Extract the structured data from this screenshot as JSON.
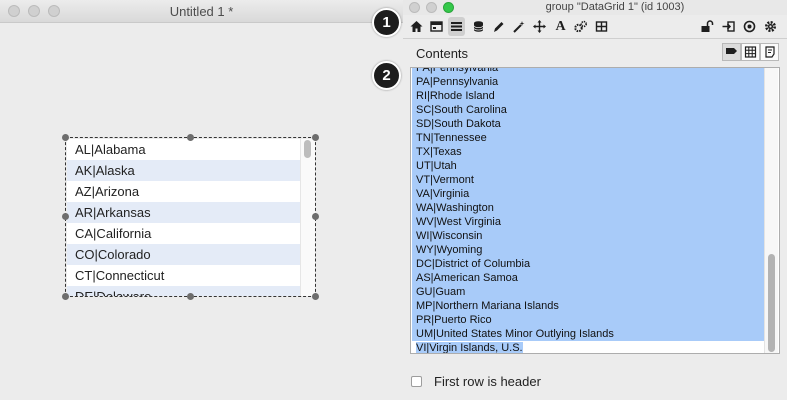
{
  "left_window": {
    "title": "Untitled 1 *",
    "grid_rows": [
      "AL|Alabama",
      "AK|Alaska",
      "AZ|Arizona",
      "AR|Arkansas",
      "CA|California",
      "CO|Colorado",
      "CT|Connecticut",
      "DE|Delaware"
    ]
  },
  "inspector": {
    "title": "group \"DataGrid 1\" (id 1003)",
    "toolbar_icons": [
      "home-icon",
      "card-icon",
      "list-icon",
      "database-icon",
      "pencil-icon",
      "magic-wand-icon",
      "move-icon",
      "text-icon",
      "gears-icon",
      "grid-icon"
    ],
    "toolbar_right_icons": [
      "lock-icon",
      "enter-icon",
      "target-icon",
      "gear-icon"
    ],
    "toolbar_text_glyph": "A",
    "contents_label": "Contents",
    "view_buttons": [
      "pencil-view-icon",
      "table-view-icon",
      "script-view-icon"
    ],
    "content_lines": [
      "PA|Pennsylvania",
      "PA|Pennsylvania",
      "RI|Rhode Island",
      "SC|South Carolina",
      "SD|South Dakota",
      "TN|Tennessee",
      "TX|Texas",
      "UT|Utah",
      "VT|Vermont",
      "VA|Virginia",
      "WA|Washington",
      "WV|West Virginia",
      "WI|Wisconsin",
      "WY|Wyoming",
      "DC|District of Columbia",
      "AS|American Samoa",
      "GU|Guam",
      "MP|Northern Mariana Islands",
      "PR|Puerto Rico",
      "UM|United States Minor Outlying Islands",
      "VI|Virgin Islands, U.S."
    ],
    "first_row_header_label": "First row is header",
    "first_row_header_checked": false
  },
  "callouts": [
    "1",
    "2"
  ],
  "colors": {
    "selection": "#a8cbf9",
    "alt_row": "#e4ebf7",
    "close": "#fc605c",
    "minimize": "#fdbc40",
    "zoom": "#34c84a"
  }
}
